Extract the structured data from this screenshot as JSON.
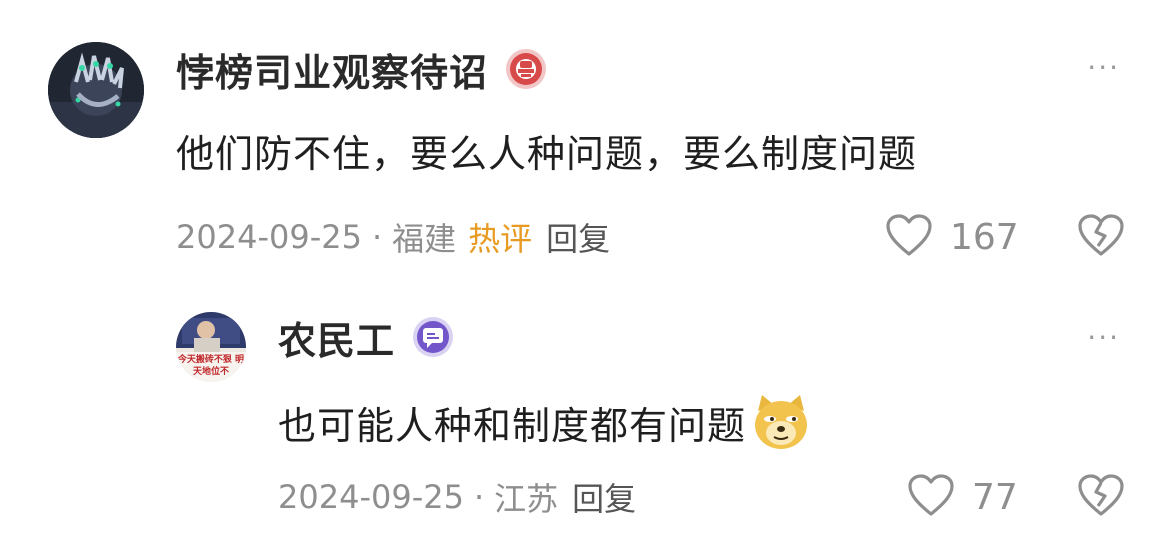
{
  "comments": [
    {
      "username": "悖榜司业观察待诏",
      "text": "他们防不住，要么人种问题，要么制度问题",
      "date": "2024-09-25",
      "separator": "·",
      "location": "福建",
      "tag": "热评",
      "reply_label": "回复",
      "like_count": "167",
      "badge_icon": "red-medal-icon",
      "avatar_desc": "dark avatar with hand image"
    },
    {
      "username": "农民工",
      "text": "也可能人种和制度都有问题",
      "date": "2024-09-25",
      "separator": "·",
      "location": "江苏",
      "reply_label": "回复",
      "like_count": "77",
      "badge_icon": "purple-chat-badge-icon",
      "emoji": "doge-emoji-icon",
      "avatar_text": "今天搬砖不狠 明天地位不"
    }
  ],
  "more_label": "···",
  "colors": {
    "hot_tag": "#e89b22",
    "muted": "#8e8e8e"
  }
}
